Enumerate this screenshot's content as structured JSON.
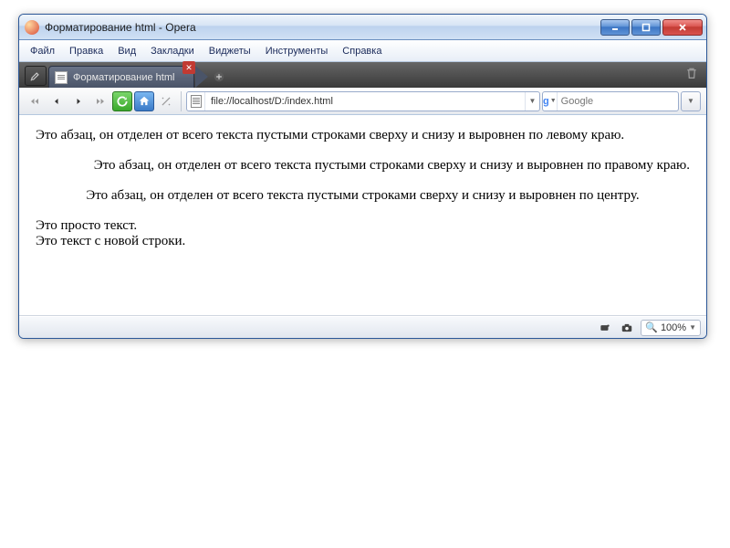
{
  "window": {
    "title": "Форматирование html - Opera"
  },
  "menu": {
    "file": "Файл",
    "edit": "Правка",
    "view": "Вид",
    "bookmarks": "Закладки",
    "widgets": "Виджеты",
    "tools": "Инструменты",
    "help": "Справка"
  },
  "tab": {
    "label": "Форматирование html"
  },
  "url": {
    "value": "file://localhost/D:/index.html"
  },
  "search": {
    "placeholder": "Google"
  },
  "page": {
    "p1": "Это абзац, он отделен от всего текста пустыми строками сверху и снизу и выровнен по левому краю.",
    "p2": "Это абзац, он отделен от всего текста пустыми строками сверху и снизу и выровнен по правому краю.",
    "p3": "Это абзац, он отделен от всего текста пустыми строками сверху и снизу и выровнен по центру.",
    "t1": "Это просто текст.",
    "t2": "Это текст с новой строки."
  },
  "status": {
    "zoom": "100%"
  }
}
